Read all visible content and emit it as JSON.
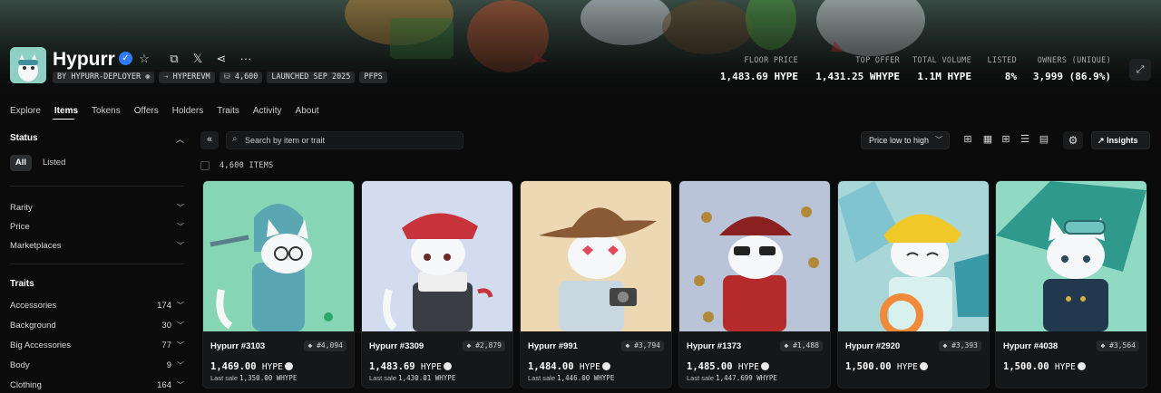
{
  "collection": {
    "name": "Hypurr",
    "chips": [
      "BY HYPURR-DEPLOYER",
      "HYPEREVM",
      "4,600",
      "LAUNCHED SEP 2025",
      "PFPS"
    ]
  },
  "stats": [
    {
      "label": "FLOOR PRICE",
      "value": "1,483.69 HYPE"
    },
    {
      "label": "TOP OFFER",
      "value": "1,431.25 WHYPE"
    },
    {
      "label": "TOTAL VOLUME",
      "value": "1.1M HYPE"
    },
    {
      "label": "LISTED",
      "value": "8%"
    },
    {
      "label": "OWNERS (UNIQUE)",
      "value": "3,999 (86.9%)"
    }
  ],
  "tabs": [
    "Explore",
    "Items",
    "Tokens",
    "Offers",
    "Holders",
    "Traits",
    "Activity",
    "About"
  ],
  "active_tab": "Items",
  "sidebar": {
    "status_title": "Status",
    "status_all": "All",
    "status_listed": "Listed",
    "filters": [
      "Rarity",
      "Price",
      "Marketplaces"
    ],
    "traits_title": "Traits",
    "traits": [
      {
        "label": "Accessories",
        "count": "174"
      },
      {
        "label": "Background",
        "count": "30"
      },
      {
        "label": "Big Accessories",
        "count": "77"
      },
      {
        "label": "Body",
        "count": "9"
      },
      {
        "label": "Clothing",
        "count": "164"
      }
    ]
  },
  "toolbar": {
    "search_placeholder": "Search by item or trait",
    "sort_label": "Price low to high",
    "insights_label": "Insights",
    "items_count": "4,600 ITEMS"
  },
  "cards": [
    {
      "name": "Hypurr #3103",
      "rank": "#4,094",
      "price": "1,469.00",
      "unit": "HYPE",
      "last_label": "Last sale",
      "last_sale": "1,350.00 WHYPE",
      "bg": "#86d5b5"
    },
    {
      "name": "Hypurr #3309",
      "rank": "#2,879",
      "price": "1,483.69",
      "unit": "HYPE",
      "last_label": "Last sale",
      "last_sale": "1,430.01 WHYPE",
      "bg": "#d2dcee"
    },
    {
      "name": "Hypurr #991",
      "rank": "#3,794",
      "price": "1,484.00",
      "unit": "HYPE",
      "last_label": "Last sale",
      "last_sale": "1,446.00 WHYPE",
      "bg": "#ecd9b3"
    },
    {
      "name": "Hypurr #1373",
      "rank": "#1,488",
      "price": "1,485.00",
      "unit": "HYPE",
      "last_label": "Last sale",
      "last_sale": "1,447.699 WHYPE",
      "bg": "#b9c4d8"
    },
    {
      "name": "Hypurr #2920",
      "rank": "#3,393",
      "price": "1,500.00",
      "unit": "HYPE",
      "last_label": "",
      "last_sale": "",
      "bg": "#a9d7d8"
    },
    {
      "name": "Hypurr #4038",
      "rank": "#3,564",
      "price": "1,500.00",
      "unit": "HYPE",
      "last_label": "",
      "last_sale": "",
      "bg": "#90d9c3"
    }
  ],
  "colors": {
    "accent": "#2d7cf6",
    "background": "#0b0b0c",
    "card": "#161718"
  }
}
